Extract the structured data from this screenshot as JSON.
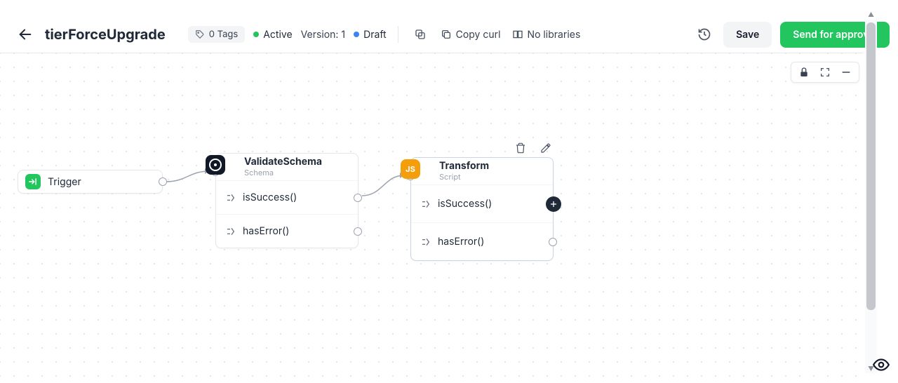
{
  "header": {
    "title": "tierForceUpgrade",
    "tags_label": "0 Tags",
    "status_active": "Active",
    "version_label": "Version: 1",
    "draft_label": "Draft",
    "copy_curl_label": "Copy curl",
    "no_libraries_label": "No libraries",
    "save_label": "Save",
    "approve_label": "Send for approval"
  },
  "nodes": {
    "trigger": {
      "label": "Trigger"
    },
    "validate": {
      "title": "ValidateSchema",
      "subtitle": "Schema",
      "branch_success": "isSuccess()",
      "branch_error": "hasError()"
    },
    "transform": {
      "title": "Transform",
      "subtitle": "Script",
      "icon_text": "JS",
      "branch_success": "isSuccess()",
      "branch_error": "hasError()"
    }
  }
}
